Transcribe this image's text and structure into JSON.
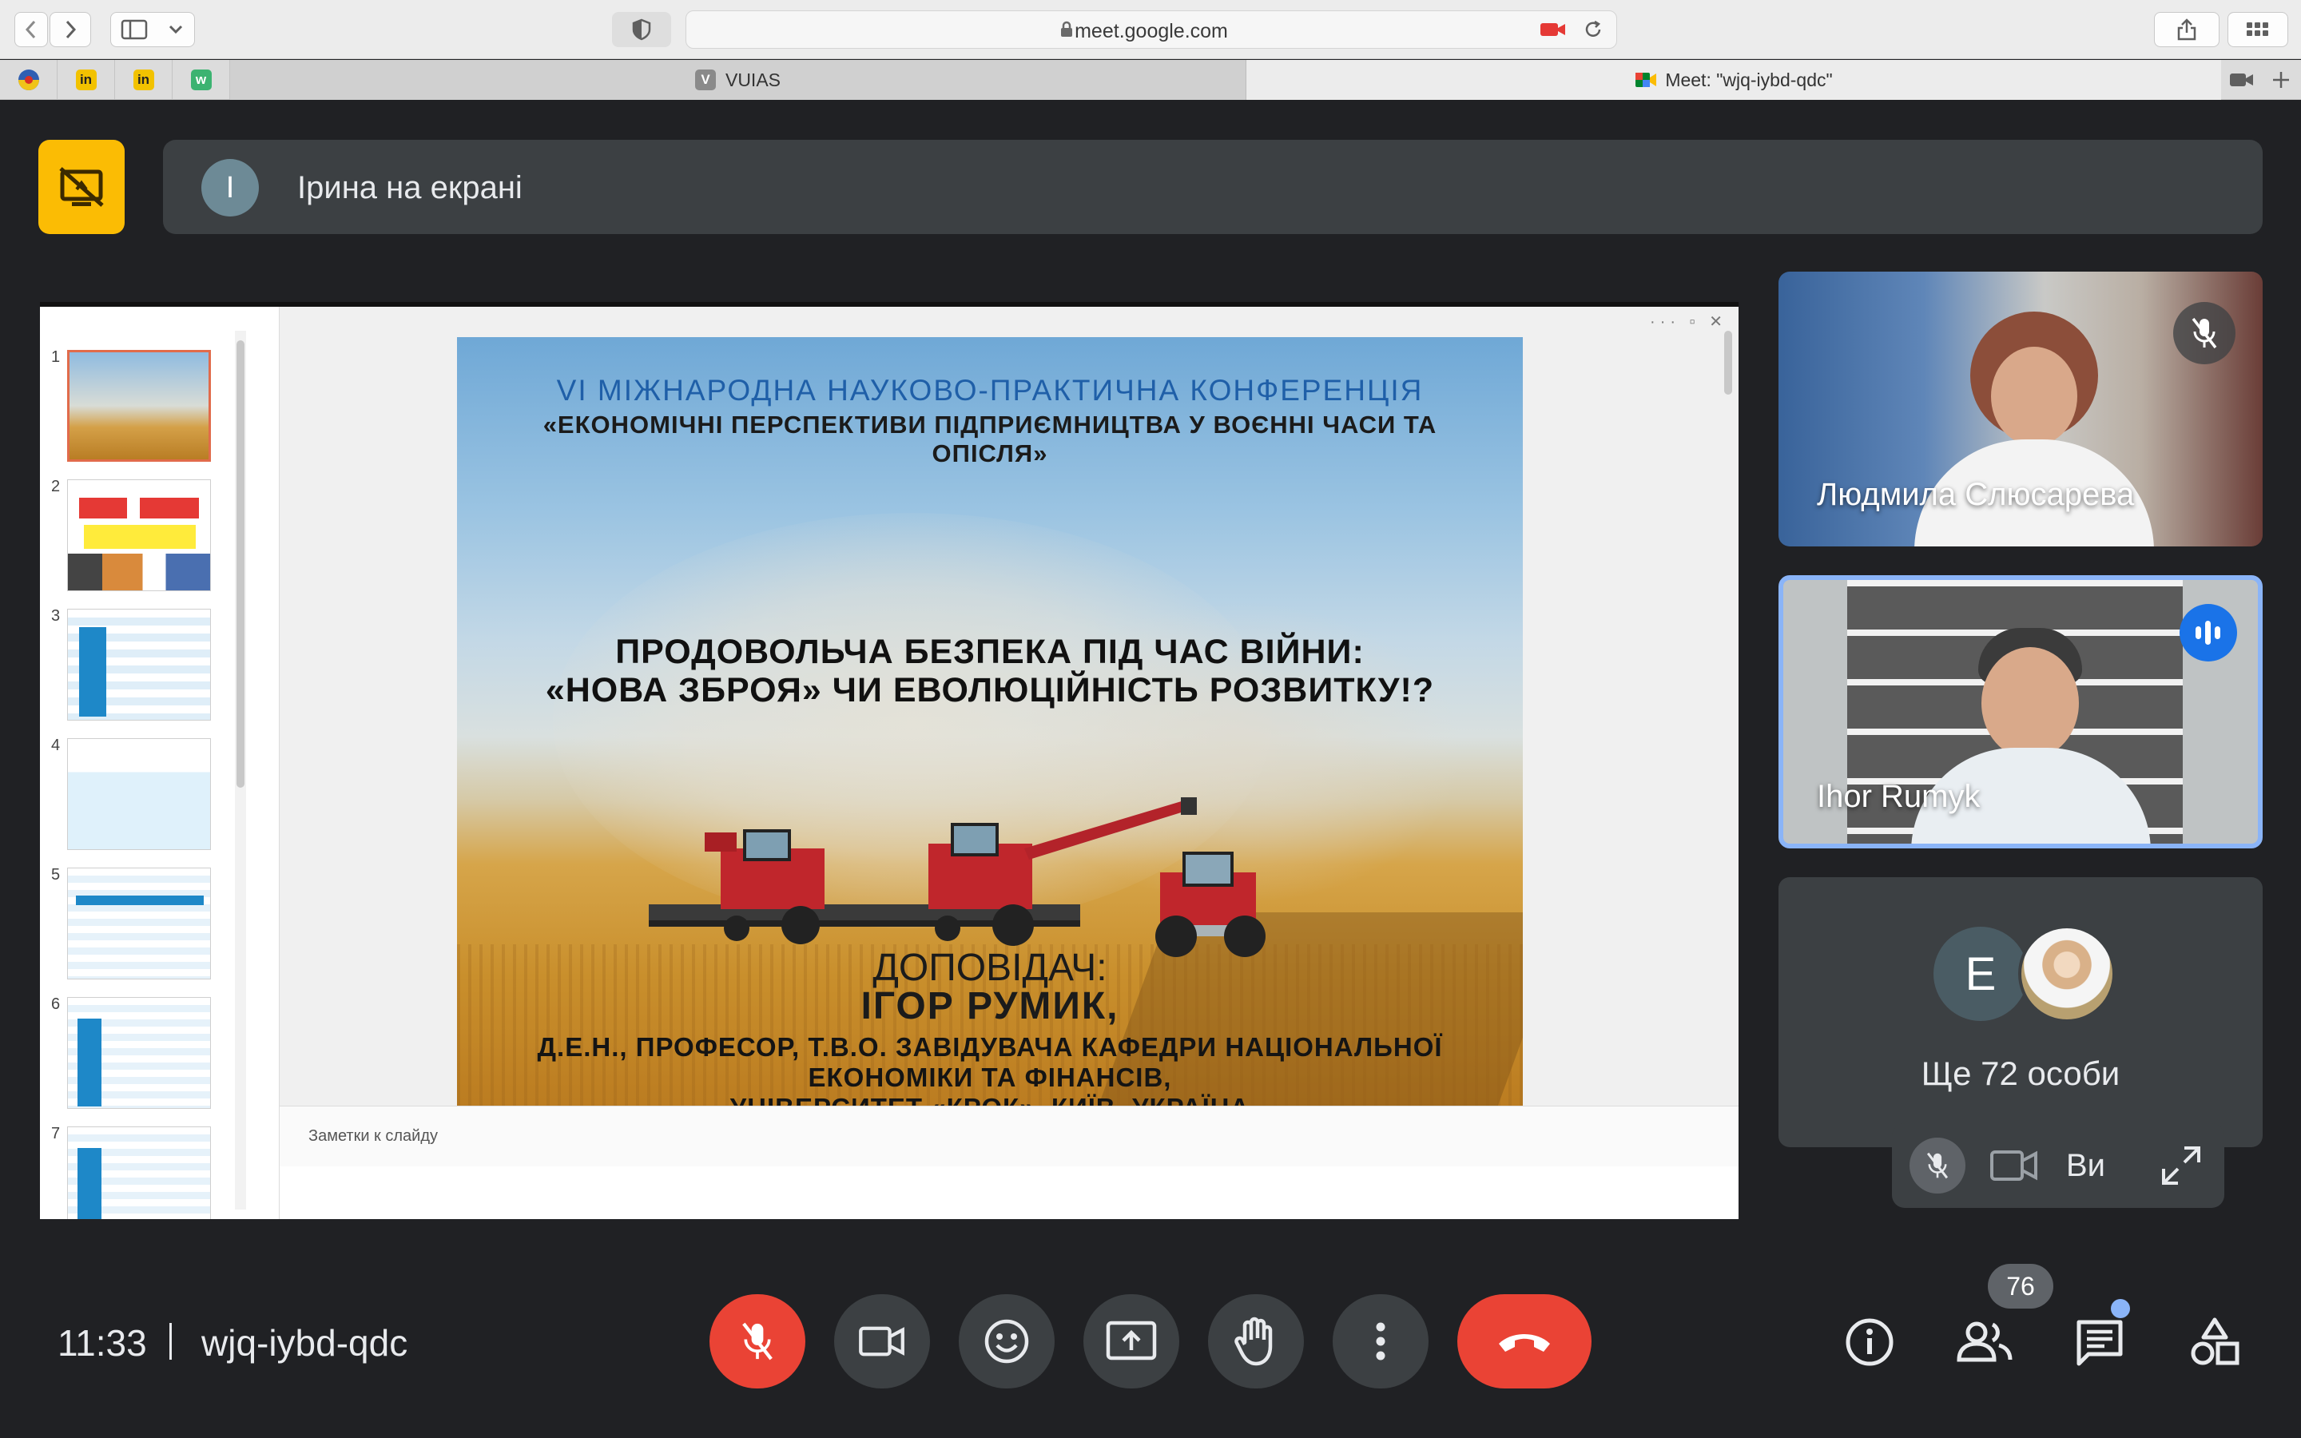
{
  "browser": {
    "url": "meet.google.com",
    "tabs": [
      {
        "title": "VUIAS",
        "favicon": "V"
      },
      {
        "title": "Meet: \"wjq-iybd-qdc\"",
        "favicon": "meet"
      }
    ],
    "pinned_tabs": [
      "ua-icon",
      "in-icon",
      "in-icon",
      "w-icon"
    ]
  },
  "presentation": {
    "avatar_initial": "I",
    "banner_text": "Ірина на екрані"
  },
  "slides": {
    "numbers": [
      "1",
      "2",
      "3",
      "4",
      "5",
      "6",
      "7"
    ],
    "notes_placeholder": "Заметки к слайду",
    "current": {
      "conference": "VI  МІЖНАРОДНА НАУКОВО-ПРАКТИЧНА КОНФЕРЕНЦІЯ",
      "subtitle_1": "«ЕКОНОМІЧНІ ПЕРСПЕКТИВИ ПІДПРИЄМНИЦТВА У ВОЄННІ ЧАСИ ТА",
      "subtitle_2": "ОПІСЛЯ»",
      "title_1": "ПРОДОВОЛЬЧА БЕЗПЕКА ПІД ЧАС ВІЙНИ:",
      "title_2": "«НОВА ЗБРОЯ» ЧИ ЕВОЛЮЦІЙНІСТЬ РОЗВИТКУ!?",
      "speaker_label": "ДОПОВІДАЧ:",
      "speaker_name": "ІГОР РУМИК,",
      "affiliation_1": "Д.Е.Н., ПРОФЕСОР, Т.В.О. ЗАВІДУВАЧА КАФЕДРИ НАЦІОНАЛЬНОЇ",
      "affiliation_2": "ЕКОНОМІКИ ТА ФІНАНСІВ,",
      "affiliation_3": "УНІВЕРСИТЕТ «КРОК», КИЇВ, УКРАЇНА"
    }
  },
  "participants": {
    "tile_1_name": "Людмила Слюсарева",
    "tile_2_name": "Ihor Rumyk",
    "others_initial": "E",
    "others_text": "Ще 72 особи",
    "self_label": "Ви"
  },
  "meeting": {
    "time": "11:33",
    "code": "wjq-iybd-qdc",
    "participant_count": "76"
  },
  "colors": {
    "background": "#202124",
    "surface": "#3c4043",
    "danger": "#ea4335",
    "accent": "#8ab4f8",
    "present_highlight": "#fbbc04",
    "speaking": "#1a73e8"
  }
}
